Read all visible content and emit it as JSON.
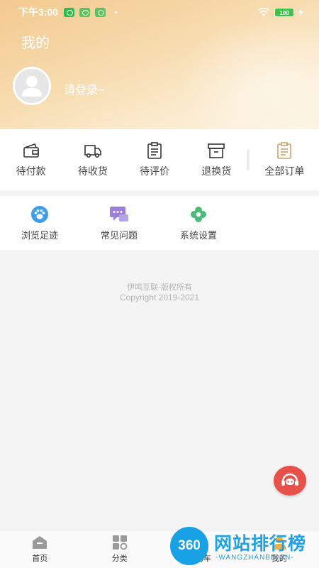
{
  "status_bar": {
    "time": "下午3:00",
    "battery": "100"
  },
  "header": {
    "title": "我的",
    "login_prompt": "请登录~"
  },
  "orders": [
    {
      "label": "待付款",
      "icon": "wallet-icon"
    },
    {
      "label": "待收货",
      "icon": "truck-icon"
    },
    {
      "label": "待评价",
      "icon": "clipboard-icon"
    },
    {
      "label": "退换货",
      "icon": "return-box-icon"
    },
    {
      "label": "全部订单",
      "icon": "orders-list-icon"
    }
  ],
  "tools": [
    {
      "label": "浏览足迹",
      "icon": "footprint-icon"
    },
    {
      "label": "常见问题",
      "icon": "faq-chat-icon"
    },
    {
      "label": "系统设置",
      "icon": "settings-flower-icon"
    }
  ],
  "copyright": {
    "line1": "伊鸣互联-版权所有",
    "line2": "Copyright 2019-2021"
  },
  "tabbar": [
    {
      "label": "首页",
      "icon": "home-icon"
    },
    {
      "label": "分类",
      "icon": "category-icon"
    },
    {
      "label": "购物车",
      "icon": "cart-icon"
    },
    {
      "label": "我的",
      "icon": "profile-icon"
    }
  ],
  "watermark": {
    "logo": "360",
    "text": "网站排行榜",
    "sub": "-WANGZHANBD.CN-"
  },
  "colors": {
    "header_gradient_start": "#f3c98f",
    "orders_accent": "#c9a46a",
    "service_button": "#e8504a",
    "footprint_icon": "#3f9ee8",
    "faq_icon": "#9b7fd8",
    "settings_icon": "#4cba78",
    "watermark_blue": "#1ea2e4"
  }
}
